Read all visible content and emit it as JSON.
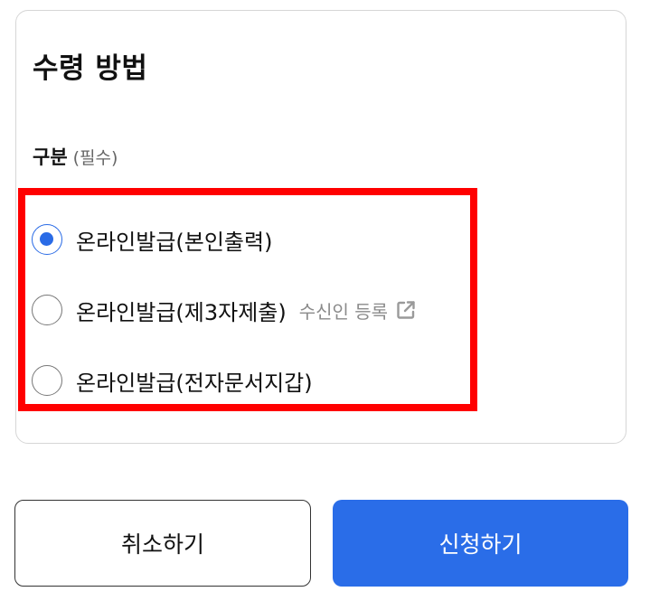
{
  "section": {
    "title": "수령 방법",
    "group_label": "구분",
    "required_note": "(필수)"
  },
  "options": [
    {
      "label": "온라인발급(본인출력)",
      "selected": true
    },
    {
      "label": "온라인발급(제3자제출)",
      "selected": false,
      "link_label": "수신인 등록",
      "link_icon": "external-link-icon"
    },
    {
      "label": "온라인발급(전자문서지갑)",
      "selected": false
    }
  ],
  "buttons": {
    "cancel_label": "취소하기",
    "submit_label": "신청하기"
  },
  "colors": {
    "accent": "#2a6de8",
    "highlight": "#ff0000",
    "muted_text": "#8a8a8a"
  }
}
